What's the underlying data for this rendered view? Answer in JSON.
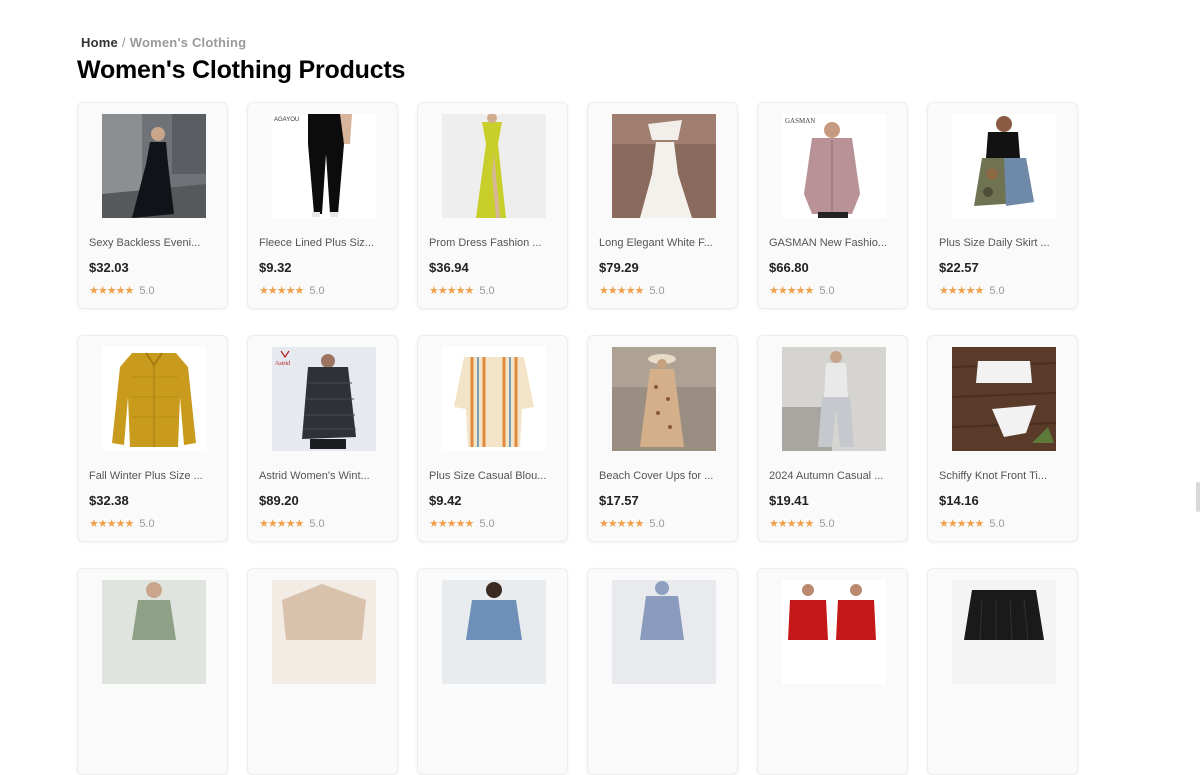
{
  "breadcrumb": {
    "home": "Home",
    "separator": "/",
    "current": "Women's Clothing"
  },
  "page_title": "Women's Clothing Products",
  "star_glyph": "★★★★★",
  "star_color": "#f0a04b",
  "products": [
    {
      "name": "Sexy Backless Eveni...",
      "price": "$32.03",
      "rating": "5.0",
      "image": "black-evening-gown"
    },
    {
      "name": "Fleece Lined Plus Siz...",
      "price": "$9.32",
      "rating": "5.0",
      "image": "black-leggings"
    },
    {
      "name": "Prom Dress Fashion ...",
      "price": "$36.94",
      "rating": "5.0",
      "image": "yellow-prom-dress"
    },
    {
      "name": "Long Elegant White F...",
      "price": "$79.29",
      "rating": "5.0",
      "image": "white-feather-gown"
    },
    {
      "name": "GASMAN New Fashio...",
      "price": "$66.80",
      "rating": "5.0",
      "image": "pink-puffer-coat"
    },
    {
      "name": "Plus Size Daily Skirt ...",
      "price": "$22.57",
      "rating": "5.0",
      "image": "camo-denim-skirt"
    },
    {
      "name": "Fall Winter Plus Size ...",
      "price": "$32.38",
      "rating": "5.0",
      "image": "mustard-quilted-jacket"
    },
    {
      "name": "Astrid Women's Wint...",
      "price": "$89.20",
      "rating": "5.0",
      "image": "grey-puffer-coat"
    },
    {
      "name": "Plus Size Casual Blou...",
      "price": "$9.42",
      "rating": "5.0",
      "image": "striped-blouse"
    },
    {
      "name": "Beach Cover Ups for ...",
      "price": "$17.57",
      "rating": "5.0",
      "image": "beach-cover-up"
    },
    {
      "name": "2024 Autumn Casual ...",
      "price": "$19.41",
      "rating": "5.0",
      "image": "grey-casual-set"
    },
    {
      "name": "Schiffy Knot Front Ti...",
      "price": "$14.16",
      "rating": "5.0",
      "image": "white-bikini"
    },
    {
      "name": "",
      "price": "",
      "rating": "",
      "image": "sage-tank-dress"
    },
    {
      "name": "",
      "price": "",
      "rating": "",
      "image": "beige-top"
    },
    {
      "name": "",
      "price": "",
      "rating": "",
      "image": "blue-shirt"
    },
    {
      "name": "",
      "price": "",
      "rating": "",
      "image": "blue-maxi-dress"
    },
    {
      "name": "",
      "price": "",
      "rating": "",
      "image": "red-dresses"
    },
    {
      "name": "",
      "price": "",
      "rating": "",
      "image": "black-fringe-top"
    }
  ]
}
